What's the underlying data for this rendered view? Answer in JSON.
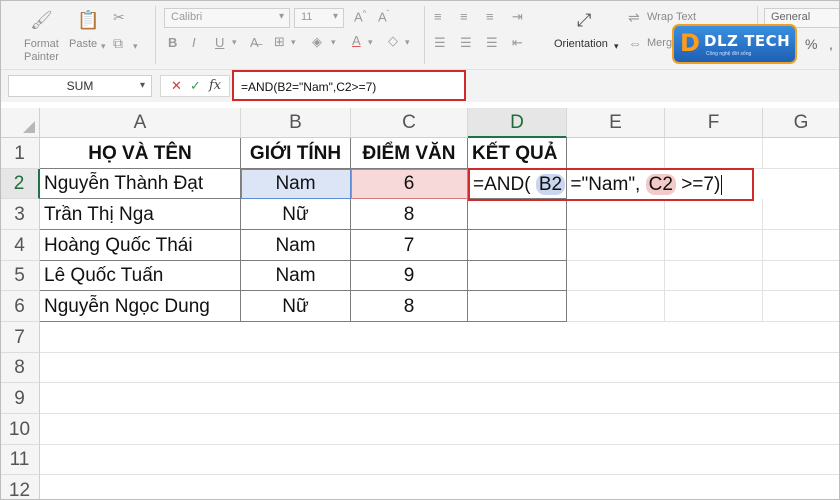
{
  "ribbon": {
    "format_painter_label_1": "Format",
    "format_painter_label_2": "Painter",
    "paste_label": "Paste",
    "font_name": "Calibri",
    "font_size": "11",
    "wrap_text_label": "Wrap Text",
    "merge_label": "Merg",
    "orientation_label": "Orientation",
    "number_format": "General",
    "percent_symbol": "%"
  },
  "logo": {
    "mark": "D",
    "text": "DLZ TECH",
    "sub": "Công nghệ đời sống"
  },
  "formula_bar": {
    "name_box": "SUM",
    "cancel_symbol": "✕",
    "enter_symbol": "✓",
    "fx_symbol": "fx",
    "formula": "=AND(B2=\"Nam\",C2>=7)"
  },
  "columns": [
    "A",
    "B",
    "C",
    "D",
    "E",
    "F",
    "G"
  ],
  "rows": [
    "1",
    "2",
    "3",
    "4",
    "5",
    "6",
    "7",
    "8",
    "9",
    "10",
    "11",
    "12"
  ],
  "table": {
    "headers": [
      "HỌ VÀ TÊN",
      "GIỚI TÍNH",
      "ĐIỂM VĂN",
      "KẾT QUẢ"
    ],
    "data": [
      [
        "Nguyễn Thành Đạt",
        "Nam",
        "6"
      ],
      [
        "Trần Thị Nga",
        "Nữ",
        "8"
      ],
      [
        "Hoàng Quốc Thái",
        "Nam",
        "7"
      ],
      [
        "Lê Quốc Tuấn",
        "Nam",
        "9"
      ],
      [
        "Nguyễn Ngọc Dung",
        "Nữ",
        "8"
      ]
    ]
  },
  "edit_cell": {
    "part1": "=AND( ",
    "ref_b": "B2",
    "part2": " =\"Nam\", ",
    "ref_c": "C2",
    "part3": " >=7)"
  },
  "colors": {
    "highlight_red": "#d12a2a",
    "ref_blue": "#dbe5f6",
    "ref_red": "#f7d9d9",
    "active_header_green": "#1f7244"
  }
}
